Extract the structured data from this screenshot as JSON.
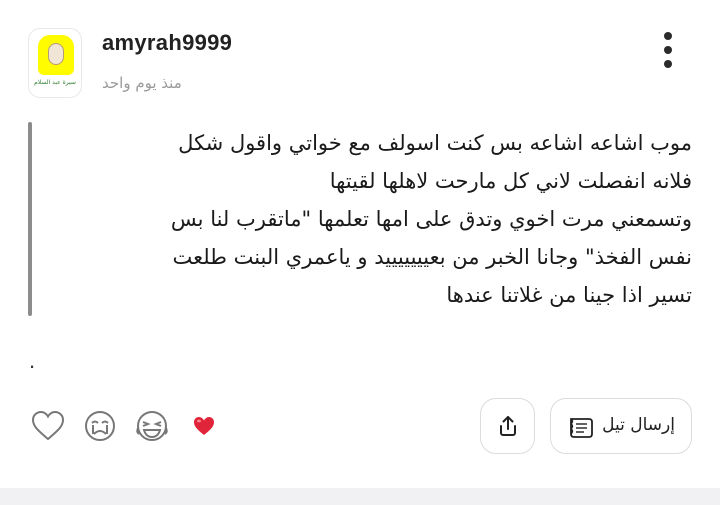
{
  "post": {
    "username": "amyrah9999",
    "timestamp": "منذ يوم واحد",
    "avatar_caption": "سيرة عبد السلام",
    "quote_lines": [
      "موب اشاعه اشاعه بس كنت اسولف مع خواتي واقول شكل",
      "فلانه انفصلت لاني كل مارحت لاهلها لقيتها",
      "وتسمعني مرت اخوي وتدق على امها تعلمها \"ماتقرب لنا بس",
      "نفس الفخذ\" وجانا الخبر من بعيييييييد و ياعمري البنت طلعت",
      "تسير اذا جينا من غلاتنا عندها"
    ],
    "trailing_text": "."
  },
  "actions": {
    "send_label": "إرسال تيل",
    "reactions": [
      "heart-outline-icon",
      "crying-face-icon",
      "laughing-face-icon",
      "red-heart-icon"
    ]
  },
  "colors": {
    "accent_heart": "#e0243a",
    "quote_bar": "#8c8c8c",
    "muted_text": "#9a9a9a"
  }
}
